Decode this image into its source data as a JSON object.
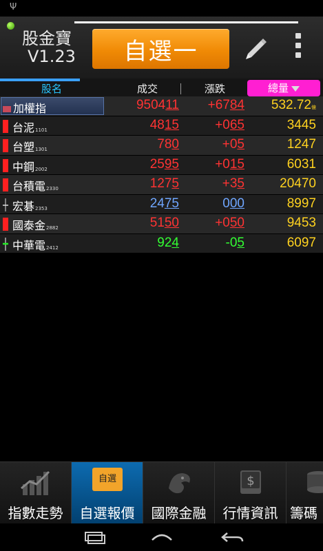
{
  "status": {
    "usb_icon": "usb-icon"
  },
  "header": {
    "app_name": "股金寶",
    "version": "V1.23",
    "group_button": "自選一"
  },
  "columns": {
    "name": "股名",
    "trade": "成交",
    "change": "漲跌",
    "volume": "總量"
  },
  "rows": [
    {
      "name": "加權指",
      "code": "",
      "trade_main": "9504",
      "trade_tail": "11",
      "change_main": "+67",
      "change_tail": "84",
      "volume": "532.72",
      "unit": "億",
      "color": "red",
      "candle": "index"
    },
    {
      "name": "台泥",
      "code": "1101",
      "trade_main": "48",
      "trade_tail": "15",
      "change_main": "+0",
      "change_tail": "65",
      "volume": "3445",
      "unit": "",
      "color": "red",
      "candle": "red"
    },
    {
      "name": "台塑",
      "code": "1301",
      "trade_main": "78",
      "trade_tail": "0",
      "change_main": "+0",
      "change_tail": "5",
      "volume": "1247",
      "unit": "",
      "color": "red",
      "candle": "red"
    },
    {
      "name": "中鋼",
      "code": "2002",
      "trade_main": "25",
      "trade_tail": "95",
      "change_main": "+0",
      "change_tail": "15",
      "volume": "6031",
      "unit": "",
      "color": "red",
      "candle": "red"
    },
    {
      "name": "台積電",
      "code": "2330",
      "trade_main": "127",
      "trade_tail": "5",
      "change_main": "+3",
      "change_tail": "5",
      "volume": "20470",
      "unit": "",
      "color": "red",
      "candle": "red"
    },
    {
      "name": "宏碁",
      "code": "2353",
      "trade_main": "24",
      "trade_tail": "75",
      "change_main": "0",
      "change_tail": "00",
      "volume": "8997",
      "unit": "",
      "color": "blue",
      "candle": "cross"
    },
    {
      "name": "國泰金",
      "code": "2882",
      "trade_main": "51",
      "trade_tail": "50",
      "change_main": "+0",
      "change_tail": "50",
      "volume": "9453",
      "unit": "",
      "color": "red",
      "candle": "red"
    },
    {
      "name": "中華電",
      "code": "2412",
      "trade_main": "92",
      "trade_tail": "4",
      "change_main": "-0",
      "change_tail": "5",
      "volume": "6097",
      "unit": "",
      "color": "green",
      "candle": "green"
    }
  ],
  "bottom_nav": {
    "index_trend": "指數走勢",
    "watchlist_quote": "自選報價",
    "watchlist_badge": "自選",
    "intl_finance": "國際金融",
    "market_info": "行情資訊",
    "chips": "籌碼"
  },
  "colors": {
    "accent_orange": "#f08a05",
    "volume_header": "#ff1fd2",
    "up": "#ff3333",
    "down": "#33ff33",
    "flat": "#6fa6ff",
    "volume": "#ffd21f"
  }
}
